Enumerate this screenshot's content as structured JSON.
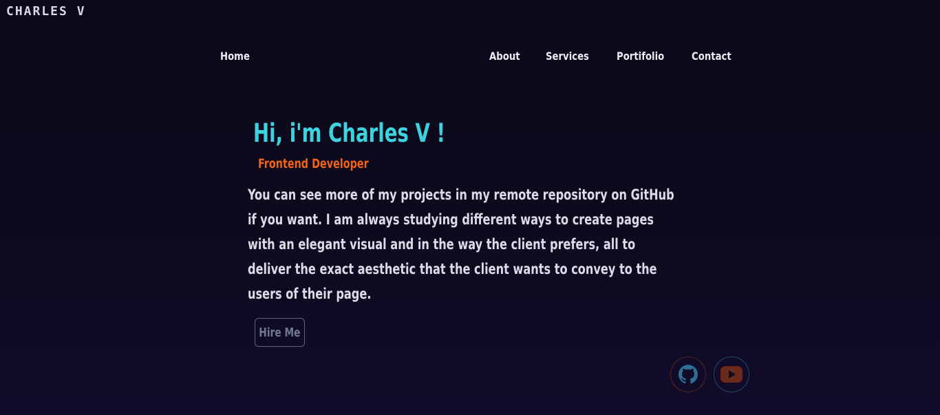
{
  "logo": "CHARLES V",
  "nav": {
    "home": "Home",
    "items": [
      "About",
      "Services",
      "Portifolio",
      "Contact"
    ]
  },
  "hero": {
    "title": "Hi, i'm Charles V !",
    "subtitle": "Frontend Developer",
    "description": "You can see more of my projects in my remote repository on GitHub if you want. I am always studying different ways to create pages with an elegant visual and in the way the client prefers, all to deliver the exact aesthetic that the client wants to convey to the users of their page.",
    "cta": "Hire Me"
  },
  "social": {
    "icons": [
      "github-icon",
      "youtube-icon"
    ]
  },
  "colors": {
    "background": "#0c0a1c",
    "title": "#3ed2df",
    "subtitle": "#f06418",
    "text": "#dcdce6"
  }
}
